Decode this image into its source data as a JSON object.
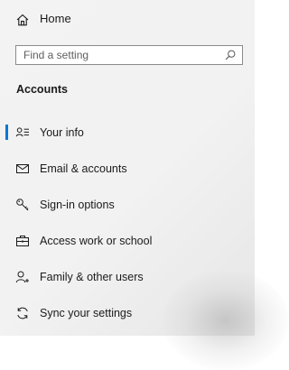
{
  "home": {
    "label": "Home",
    "icon": "home-icon"
  },
  "search": {
    "placeholder": "Find a setting",
    "value": "",
    "icon": "search-icon"
  },
  "section": {
    "heading": "Accounts"
  },
  "nav": {
    "items": [
      {
        "label": "Your info",
        "icon": "person-list-icon",
        "selected": true
      },
      {
        "label": "Email & accounts",
        "icon": "mail-icon",
        "selected": false
      },
      {
        "label": "Sign-in options",
        "icon": "key-icon",
        "selected": false
      },
      {
        "label": "Access work or school",
        "icon": "briefcase-icon",
        "selected": false
      },
      {
        "label": "Family & other users",
        "icon": "person-add-icon",
        "selected": false
      },
      {
        "label": "Sync your settings",
        "icon": "sync-icon",
        "selected": false
      }
    ]
  },
  "colors": {
    "accent": "#0078d7",
    "background": "#f2f2f2",
    "text": "#1a1a1a"
  }
}
